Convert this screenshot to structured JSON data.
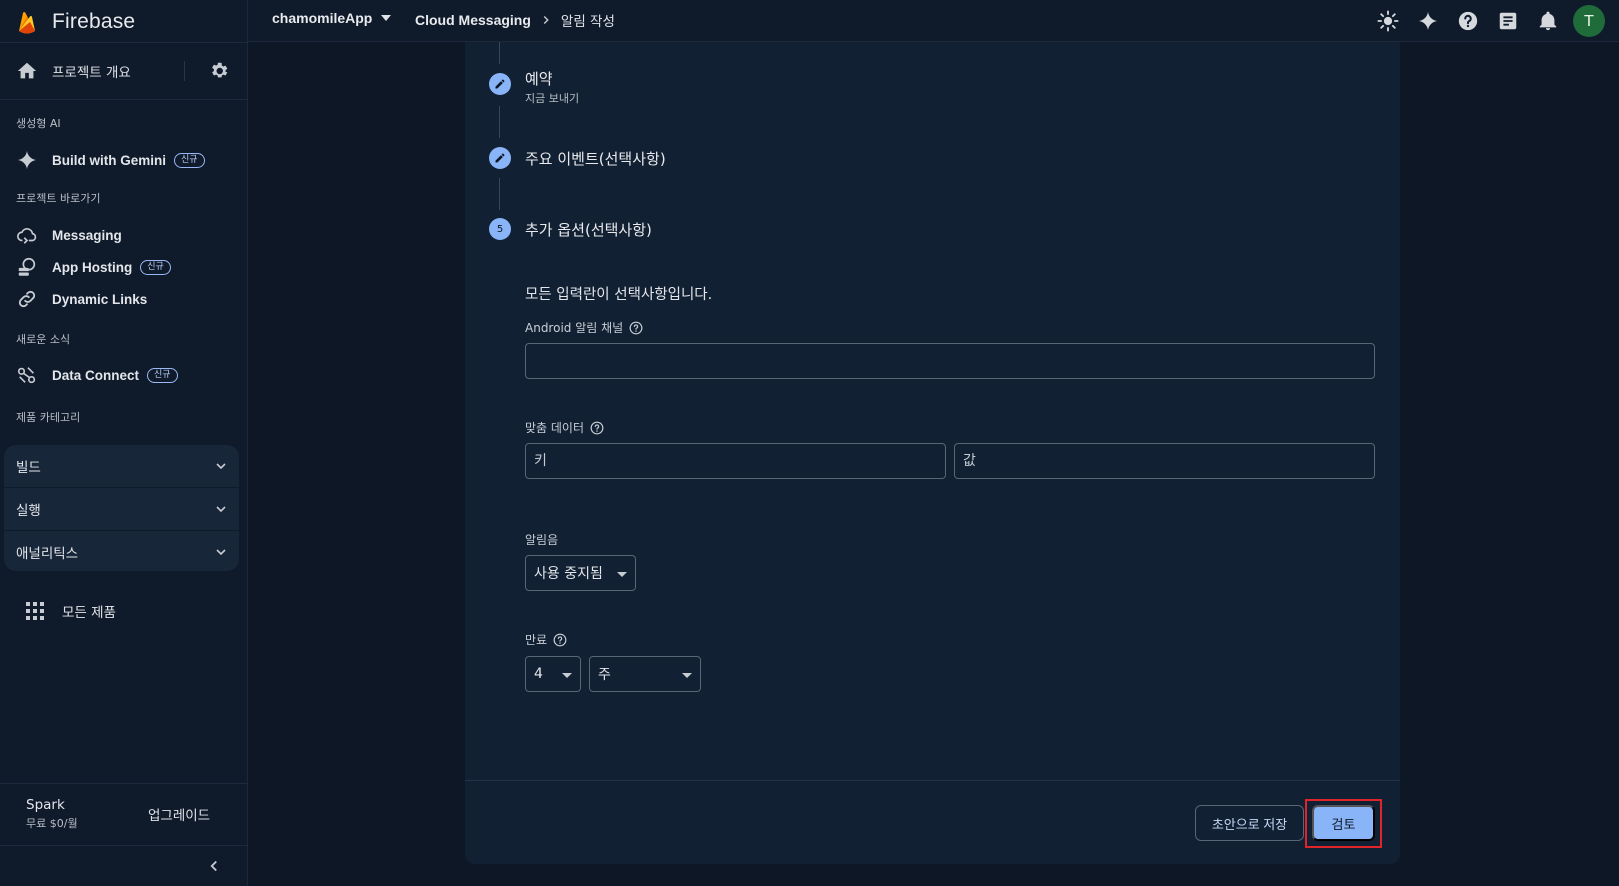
{
  "brand": {
    "name": "Firebase"
  },
  "sidebar": {
    "overview_label": "프로젝트 개요",
    "sections": {
      "gen_ai": "생성형 AI",
      "shortcuts": "프로젝트 바로가기",
      "whats_new": "새로운 소식",
      "categories": "제품 카테고리"
    },
    "items": {
      "gemini": {
        "label": "Build with Gemini",
        "badge": "신규"
      },
      "messaging": {
        "label": "Messaging"
      },
      "app_hosting": {
        "label": "App Hosting",
        "badge": "신규"
      },
      "dynamic_links": {
        "label": "Dynamic Links"
      },
      "data_connect": {
        "label": "Data Connect",
        "badge": "신규"
      }
    },
    "categories": [
      "빌드",
      "실행",
      "애널리틱스"
    ],
    "all_products": "모든 제품",
    "plan": {
      "name": "Spark",
      "price": "무료 $0/월",
      "upgrade": "업그레이드"
    }
  },
  "topbar": {
    "project": "chamomileApp",
    "breadcrumb": [
      "Cloud Messaging",
      "알림 작성"
    ],
    "avatar_initial": "T",
    "icons": [
      "brightness-icon",
      "gemini-sparkle-icon",
      "help-icon",
      "release-notes-icon",
      "notifications-icon"
    ]
  },
  "steps": {
    "schedule": {
      "title": "예약",
      "subtitle": "지금 보내기"
    },
    "conversion": {
      "title": "주요 이벤트(선택사항)"
    },
    "options": {
      "number": "5",
      "title": "추가 옵션(선택사항)"
    }
  },
  "form": {
    "description": "모든 입력란이 선택사항입니다.",
    "android_channel": {
      "label": "Android 알림 채널",
      "value": ""
    },
    "custom_data": {
      "label": "맞춤 데이터",
      "key_placeholder": "키",
      "value_placeholder": "값"
    },
    "sound": {
      "label": "알림음",
      "value": "사용 중지됨"
    },
    "expiry": {
      "label": "만료",
      "amount": "4",
      "unit": "주"
    }
  },
  "actions": {
    "save_draft": "초안으로 저장",
    "review": "검토"
  },
  "colors": {
    "accent": "#8ab4f8",
    "background": "#0d1726",
    "card": "#122033",
    "highlight": "#e0252a"
  }
}
